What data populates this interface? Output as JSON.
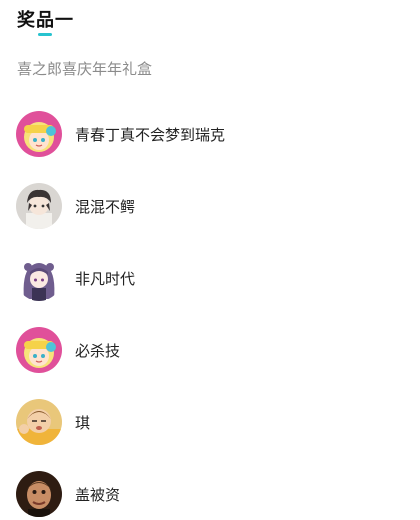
{
  "prize": {
    "title": "奖品一",
    "name": "喜之郎喜庆年年礼盒",
    "accent_color": "#27c3cf"
  },
  "winners": [
    {
      "name": "青春丁真不会梦到瑞克",
      "avatar": "anime-girl-avatar"
    },
    {
      "name": "混混不鳄",
      "avatar": "anime-boy-avatar"
    },
    {
      "name": "非凡时代",
      "avatar": "purple-hair-girl-avatar"
    },
    {
      "name": "必杀技",
      "avatar": "anime-girl-avatar"
    },
    {
      "name": "琪",
      "avatar": "baby-photo-avatar"
    },
    {
      "name": "盖被资",
      "avatar": "meme-photo-avatar"
    }
  ]
}
